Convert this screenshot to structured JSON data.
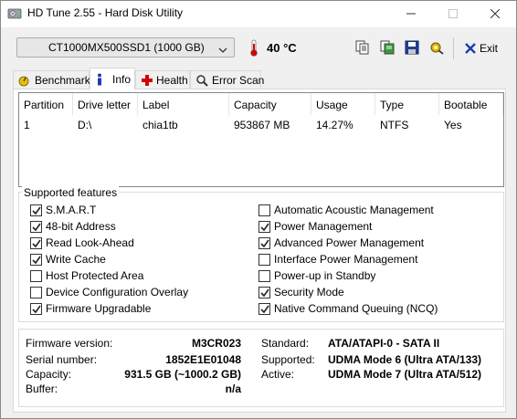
{
  "window": {
    "title": "HD Tune 2.55 - Hard Disk Utility",
    "icon": "hd-tune-app-icon"
  },
  "toolbar": {
    "drive_selected": "CT1000MX500SSD1 (1000 GB)",
    "temperature": "40 °C",
    "icons": [
      "copy-text-icon",
      "copy-screenshot-icon",
      "save-icon",
      "options-icon"
    ],
    "exit_label": "Exit",
    "temperature_color": "#c00000"
  },
  "tabs": [
    {
      "label": "Benchmark",
      "icon": "benchmark-icon"
    },
    {
      "label": "Info",
      "icon": "info-icon",
      "active": true
    },
    {
      "label": "Health",
      "icon": "health-icon"
    },
    {
      "label": "Error Scan",
      "icon": "error-scan-icon"
    }
  ],
  "partitions": {
    "headers": [
      "Partition",
      "Drive letter",
      "Label",
      "Capacity",
      "Usage",
      "Type",
      "Bootable"
    ],
    "rows": [
      [
        "1",
        "D:\\",
        "chia1tb",
        "953867 MB",
        "14.27%",
        "NTFS",
        "Yes"
      ]
    ]
  },
  "features": {
    "title": "Supported features",
    "left": [
      {
        "label": "S.M.A.R.T",
        "checked": true
      },
      {
        "label": "48-bit Address",
        "checked": true
      },
      {
        "label": "Read Look-Ahead",
        "checked": true
      },
      {
        "label": "Write Cache",
        "checked": true
      },
      {
        "label": "Host Protected Area",
        "checked": false
      },
      {
        "label": "Device Configuration Overlay",
        "checked": false
      },
      {
        "label": "Firmware Upgradable",
        "checked": true
      }
    ],
    "right": [
      {
        "label": "Automatic Acoustic Management",
        "checked": false
      },
      {
        "label": "Power Management",
        "checked": true
      },
      {
        "label": "Advanced Power Management",
        "checked": true
      },
      {
        "label": "Interface Power Management",
        "checked": false
      },
      {
        "label": "Power-up in Standby",
        "checked": false
      },
      {
        "label": "Security Mode",
        "checked": true
      },
      {
        "label": "Native Command Queuing (NCQ)",
        "checked": true
      }
    ]
  },
  "info": {
    "firmware_label": "Firmware version:",
    "firmware": "M3CR023",
    "serial_label": "Serial number:",
    "serial": "1852E1E01048",
    "capacity_label": "Capacity:",
    "capacity": "931.5 GB (~1000.2 GB)",
    "buffer_label": "Buffer:",
    "buffer": "n/a",
    "standard_label": "Standard:",
    "standard": "ATA/ATAPI-0 - SATA II",
    "supported_label": "Supported:",
    "supported": "UDMA Mode 6 (Ultra ATA/133)",
    "active_label": "Active:",
    "active": "UDMA Mode 7 (Ultra ATA/512)"
  }
}
